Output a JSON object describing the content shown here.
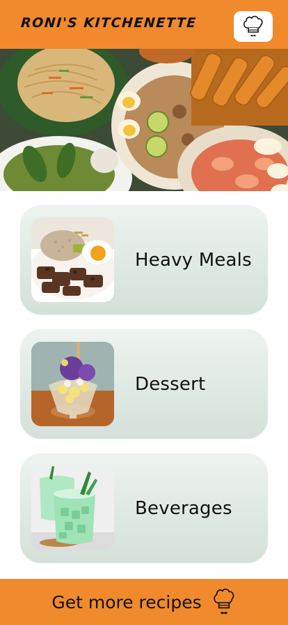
{
  "header": {
    "brand": "RONI'S KITCHENETTE",
    "chef_icon": "chef-hat-mustache-icon"
  },
  "hero": {
    "image": "filipino-dishes-banner"
  },
  "categories": [
    {
      "label": "Heavy Meals",
      "image": "beef-tapa-rice-egg"
    },
    {
      "label": "Dessert",
      "image": "halo-halo"
    },
    {
      "label": "Beverages",
      "image": "buko-pandan-drink"
    }
  ],
  "footer": {
    "label": "Get more recipes",
    "icon": "chef-hat-mustache-icon"
  },
  "colors": {
    "accent": "#f08a2c",
    "card": "#dfe9e3",
    "text": "#111111"
  }
}
